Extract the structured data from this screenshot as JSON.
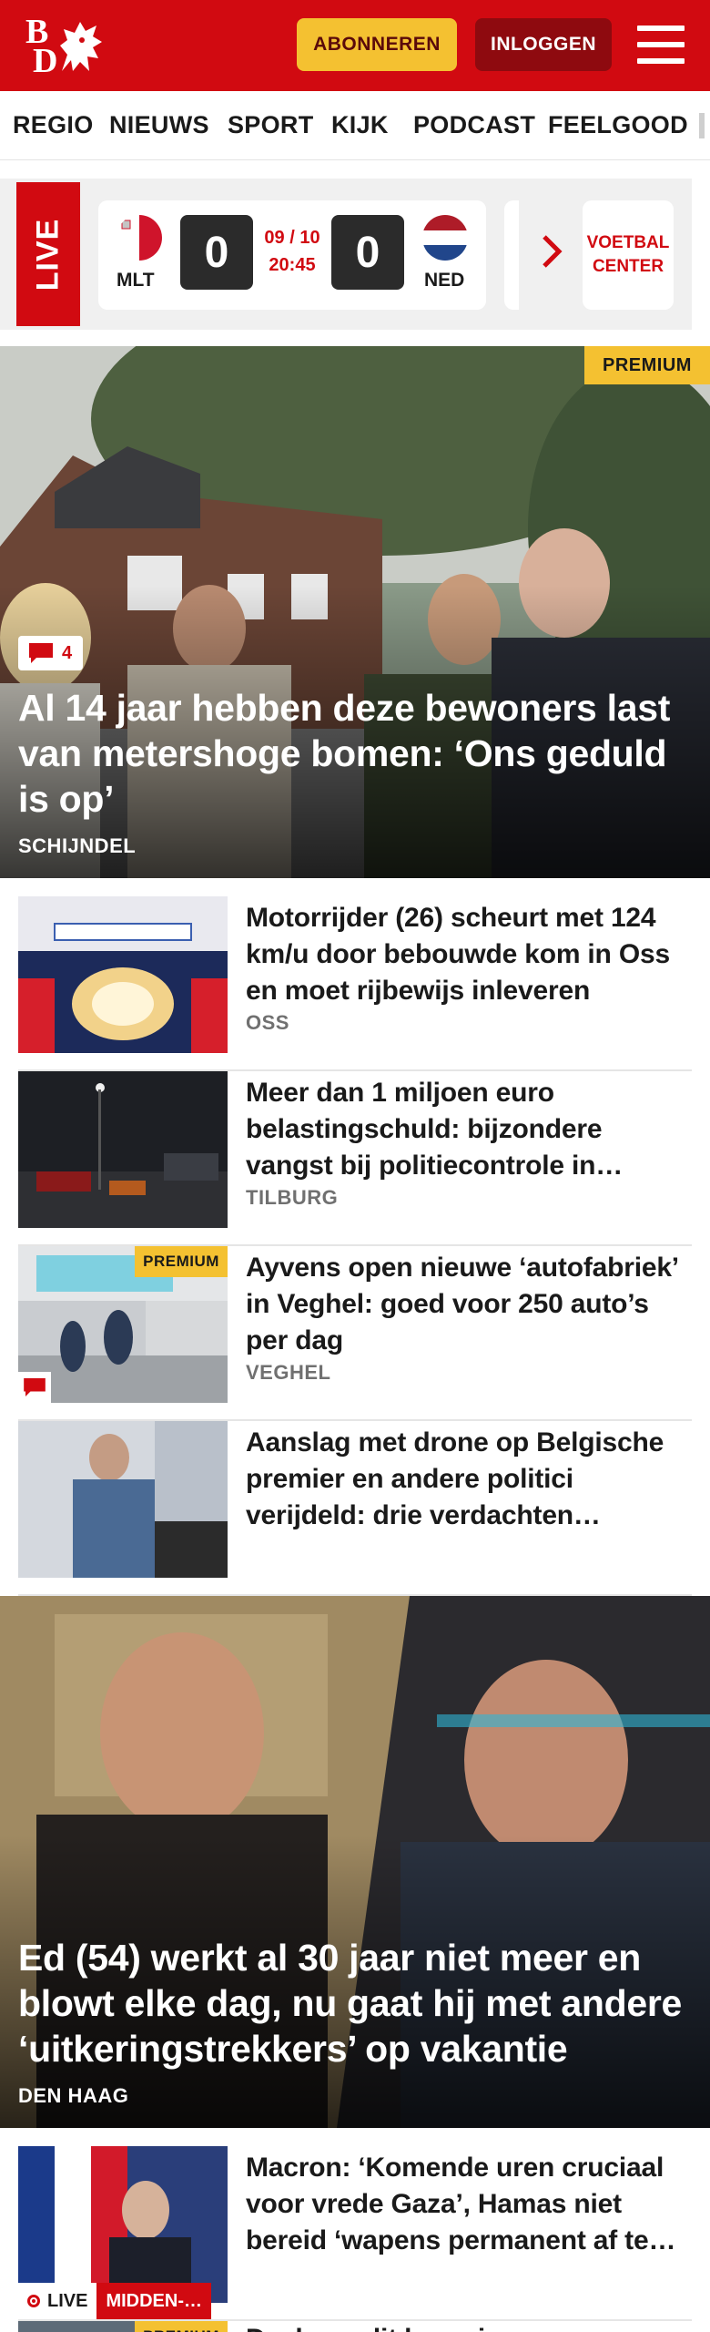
{
  "header": {
    "logo_letters": [
      "B",
      "D"
    ],
    "subscribe_label": "ABONNEREN",
    "login_label": "INLOGGEN",
    "menu_icon": "hamburger-icon",
    "brand_color": "#d10a11"
  },
  "nav": {
    "items": [
      "REGIO",
      "NIEUWS",
      "SPORT",
      "KIJK",
      "PODCAST",
      "FEELGOOD"
    ]
  },
  "live": {
    "label": "LIVE",
    "match": {
      "home_code": "MLT",
      "home_score": "0",
      "date": "09 / 10",
      "time": "20:45",
      "away_score": "0",
      "away_code": "NED"
    },
    "voetbal_center_label": "VOETBAL CENTER"
  },
  "hero": {
    "premium_label": "PREMIUM",
    "comment_count": "4",
    "title": "Al 14 jaar hebben deze bewoners last van metershoge bomen: ‘Ons geduld is op’",
    "location": "SCHIJNDEL"
  },
  "articles": [
    {
      "title": "Motorrijder (26) scheurt met 124 km/u door bebouwde kom in Oss en moet rijbewijs inleveren",
      "location": "OSS",
      "premium": false,
      "comments": false
    },
    {
      "title": "Meer dan 1 miljoen euro belastingschuld: bijzondere vangst bij politiecontrole in…",
      "location": "TILBURG",
      "premium": false,
      "comments": false
    },
    {
      "title": "Ayvens open nieuwe ‘autofa­briek’ in Veghel: goed voor 250 auto’s per dag",
      "location": "VEGHEL",
      "premium": true,
      "premium_label": "PREMIUM",
      "comments": true
    },
    {
      "title": "Aanslag met drone op Belgische premier en andere politici verijdeld: drie verdachten…",
      "location": "",
      "premium": false,
      "comments": false
    }
  ],
  "hero2": {
    "title": "Ed (54) werkt al 30 jaar niet meer en blowt elke dag, nu gaat hij met andere ‘uitkeringstrekkers’ op vakantie",
    "location": "DEN HAAG"
  },
  "article_live": {
    "title": "Macron: ‘Komende uren cruciaal voor vrede Gaza’, Hamas niet bereid ‘wapens permanent af te…",
    "live_label": "LIVE",
    "category": "MIDDEN-…"
  },
  "article_partial": {
    "premium_label": "PREMIUM",
    "title": "Deel van dit lawaai…"
  }
}
